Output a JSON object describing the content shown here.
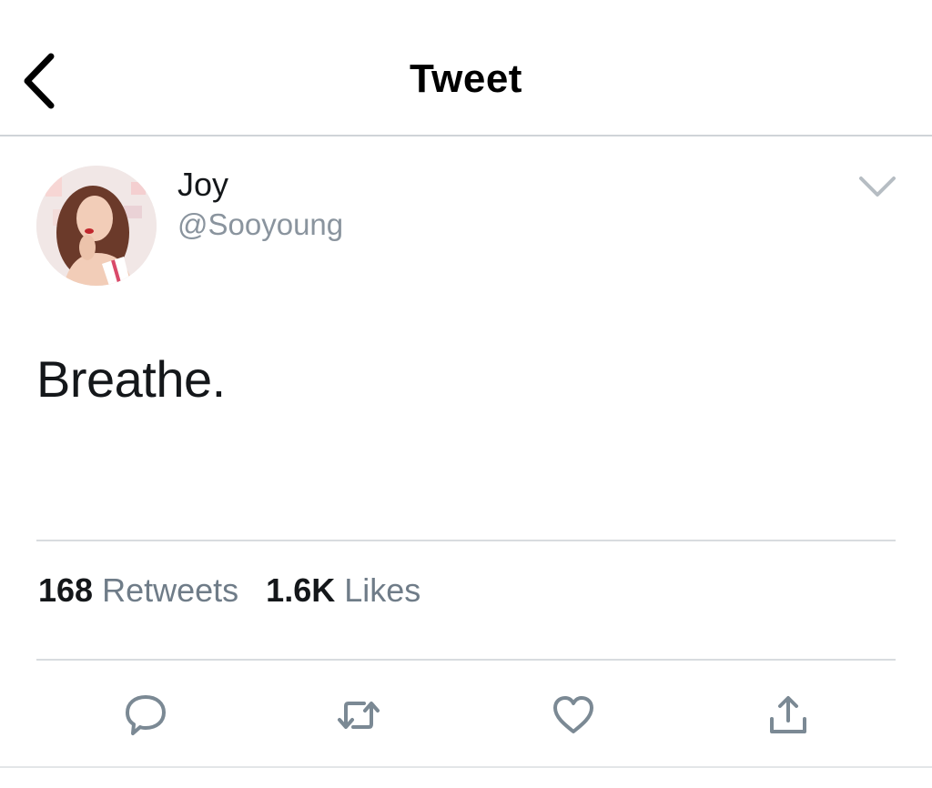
{
  "header": {
    "title": "Tweet",
    "back_icon": "chevron-left-icon"
  },
  "tweet": {
    "author": {
      "display_name": "Joy",
      "handle": "@Sooyoung",
      "avatar_icon": "profile-photo"
    },
    "menu_icon": "chevron-down-icon",
    "text": "Breathe.",
    "stats": {
      "retweets_count": "168",
      "retweets_label": "Retweets",
      "likes_count": "1.6K",
      "likes_label": "Likes"
    },
    "actions": [
      {
        "name": "reply",
        "icon": "comment-icon"
      },
      {
        "name": "retweet",
        "icon": "retweet-icon"
      },
      {
        "name": "like",
        "icon": "heart-icon"
      },
      {
        "name": "share",
        "icon": "share-icon"
      }
    ]
  },
  "colors": {
    "text_primary": "#14171a",
    "text_secondary": "#6f7c88",
    "icon_gray": "#7b8994",
    "divider": "#d8dcdf"
  }
}
